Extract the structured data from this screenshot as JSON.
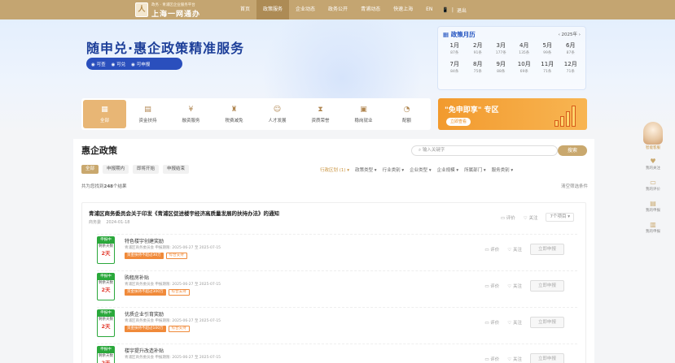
{
  "header": {
    "logo_glyph": "人",
    "logo_sub": "政务 · 青浦区企业服务平台",
    "logo_title": "上海一网通办",
    "nav": [
      {
        "label": "首页",
        "active": false
      },
      {
        "label": "政策服务",
        "active": true
      },
      {
        "label": "企业动态",
        "active": false
      },
      {
        "label": "政务公开",
        "active": false
      },
      {
        "label": "青浦动态",
        "active": false
      },
      {
        "label": "快速上海",
        "active": false
      },
      {
        "label": "EN",
        "active": false
      }
    ],
    "mobile_icon": "📱",
    "user_label": "退出",
    "divider": "|"
  },
  "banner": {
    "title": "随申兑·惠企政策精准服务",
    "tags": [
      "可查",
      "可兑",
      "可申报"
    ]
  },
  "calendar": {
    "title": "政策月历",
    "year": "2025年",
    "months": [
      {
        "m": "1月",
        "c": "87条"
      },
      {
        "m": "2月",
        "c": "91条"
      },
      {
        "m": "3月",
        "c": "177条"
      },
      {
        "m": "4月",
        "c": "135条"
      },
      {
        "m": "5月",
        "c": "99条"
      },
      {
        "m": "6月",
        "c": "87条"
      },
      {
        "m": "7月",
        "c": "84条"
      },
      {
        "m": "8月",
        "c": "75条"
      },
      {
        "m": "9月",
        "c": "88条"
      },
      {
        "m": "10月",
        "c": "69条"
      },
      {
        "m": "11月",
        "c": "71条"
      },
      {
        "m": "12月",
        "c": "71条"
      }
    ]
  },
  "categories": [
    {
      "label": "全部",
      "icon": "▦",
      "active": true
    },
    {
      "label": "资金扶持",
      "icon": "▤",
      "active": false
    },
    {
      "label": "融资服务",
      "icon": "¥",
      "active": false
    },
    {
      "label": "税费减免",
      "icon": "♜",
      "active": false
    },
    {
      "label": "人才发展",
      "icon": "☺",
      "active": false
    },
    {
      "label": "资质荣誉",
      "icon": "⧗",
      "active": false
    },
    {
      "label": "稳岗就业",
      "icon": "▣",
      "active": false
    },
    {
      "label": "配额",
      "icon": "◔",
      "active": false
    }
  ],
  "promo": {
    "title": "\"免申即享\" 专区",
    "button": "立即查看"
  },
  "main": {
    "title": "惠企政策",
    "search_placeholder": "输入关键字",
    "search_button": "搜索",
    "tabs": [
      {
        "label": "全部",
        "active": true
      },
      {
        "label": "申报期内",
        "active": false
      },
      {
        "label": "即将开始",
        "active": false
      },
      {
        "label": "申报结束",
        "active": false
      }
    ],
    "filters": [
      {
        "label": "行政区划 (1) ▾",
        "active": true
      },
      {
        "label": "政策类型 ▾",
        "active": false
      },
      {
        "label": "行业类别 ▾",
        "active": false
      },
      {
        "label": "企业类型 ▾",
        "active": false
      },
      {
        "label": "企业规模 ▾",
        "active": false
      },
      {
        "label": "所属部门 ▾",
        "active": false
      },
      {
        "label": "服务类别 ▾",
        "active": false
      }
    ],
    "result_prefix": "共为您找到",
    "result_count": "248",
    "result_suffix": "个结果",
    "view_link": "清空筛选条件"
  },
  "policy": {
    "title": "青浦区商务委员会关于印发《青浦区促进楼宇经济高质量发展的扶持办法》的通知",
    "source": "商务委",
    "date": "2024-01-18",
    "evaluate": "评价",
    "follow": "关注",
    "project_count": "7个项目 ▾"
  },
  "projects": [
    {
      "badge_head": "申报中",
      "badge_mid": "剩余天数",
      "badge_num": "2天",
      "name": "特色楼宇创建奖励",
      "org": "青浦区商务委员会   申报期限: 2025-06-27 至 2025-07-15",
      "tags": [
        {
          "label": "资金扶持不超过30万",
          "style": "solid"
        },
        {
          "label": "综合支持",
          "style": "outline"
        }
      ],
      "evaluate": "评价",
      "follow": "关注",
      "apply": "立即申报"
    },
    {
      "badge_head": "申报中",
      "badge_mid": "剩余天数",
      "badge_num": "2天",
      "name": "购租房补贴",
      "org": "青浦区商务委员会   申报期限: 2025-06-27 至 2025-07-15",
      "tags": [
        {
          "label": "资金扶持不超过300万",
          "style": "solid"
        },
        {
          "label": "综合支持",
          "style": "outline"
        }
      ],
      "evaluate": "评价",
      "follow": "关注",
      "apply": "立即申报"
    },
    {
      "badge_head": "申报中",
      "badge_mid": "剩余天数",
      "badge_num": "2天",
      "name": "优质企业引育奖励",
      "org": "青浦区商务委员会   申报期限: 2025-06-27 至 2025-07-15",
      "tags": [
        {
          "label": "资金扶持不超过100万",
          "style": "solid"
        },
        {
          "label": "综合支持",
          "style": "outline"
        }
      ],
      "evaluate": "评价",
      "follow": "关注",
      "apply": "立即申报"
    },
    {
      "badge_head": "申报中",
      "badge_mid": "剩余天数",
      "badge_num": "2天",
      "name": "楼宇提升改造补贴",
      "org": "青浦区商务委员会   申报期限: 2025-06-27 至 2025-07-15",
      "tags": [],
      "evaluate": "评价",
      "follow": "关注",
      "apply": "立即申报"
    }
  ],
  "side": {
    "mascot_label": "智能客服",
    "items": [
      {
        "label": "我的关注",
        "icon": "♥"
      },
      {
        "label": "我的评价",
        "icon": "▭"
      },
      {
        "label": "我的申报",
        "icon": "▤"
      },
      {
        "label": "我的申报",
        "icon": "▥"
      }
    ]
  },
  "colors": {
    "header": "#c4a571",
    "accent": "#c9a86e",
    "brand_blue": "#1d3f99",
    "promo_orange": "#f29a2e",
    "status_green": "#2aa83b"
  }
}
